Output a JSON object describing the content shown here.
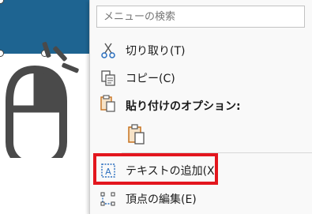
{
  "search": {
    "placeholder": "メニューの検索"
  },
  "menu": {
    "items": [
      {
        "label": "切り取り(T)",
        "icon": "scissors-icon"
      },
      {
        "label": "コピー(C)",
        "icon": "copy-icon"
      },
      {
        "label": "貼り付けのオプション:",
        "icon": "paste-icon"
      },
      {
        "label": "テキストの追加(X)",
        "icon": "text-box-icon"
      },
      {
        "label": "頂点の編集(E)",
        "icon": "edit-points-icon"
      }
    ],
    "paste_option_icon": "paste-keep-source-icon"
  },
  "colors": {
    "shape_fill": "#1e6491",
    "highlight": "#e3161e",
    "mouse_gray": "#4a4a4a",
    "icon_blue": "#2b6fbf",
    "icon_orange": "#c7721f"
  }
}
